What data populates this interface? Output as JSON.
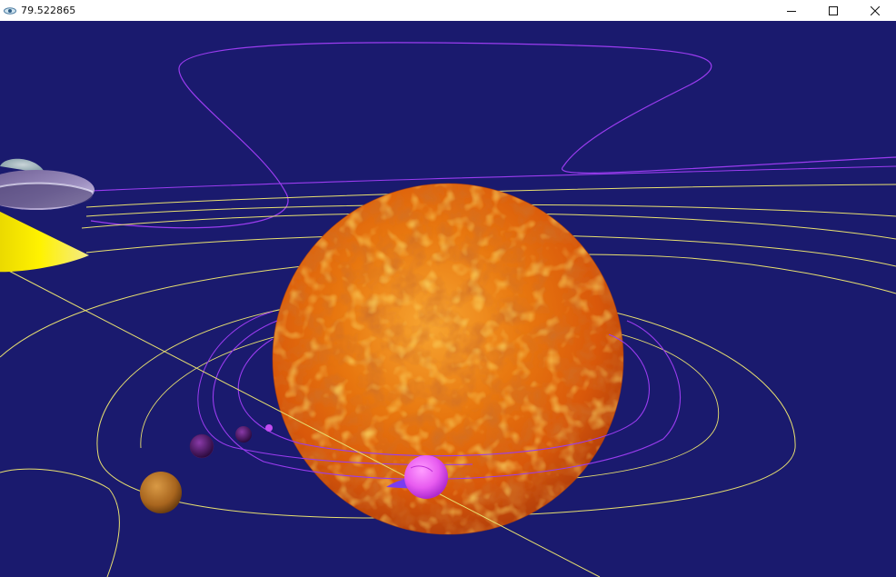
{
  "window": {
    "title": "79.522865",
    "icon": "eye-app-icon",
    "controls": [
      {
        "name": "minimize",
        "icon": "minimize-icon"
      },
      {
        "name": "maximize",
        "icon": "maximize-icon"
      },
      {
        "name": "close",
        "icon": "close-icon"
      }
    ]
  },
  "scene": {
    "background_color": "#1a1a6e",
    "sun_color": "#e8770f",
    "orbit_yellow": "#e8e070",
    "orbit_purple": "#9b3cf0",
    "ufo_cone_color": "#f2e600",
    "comet_color": "#e85cf0"
  }
}
